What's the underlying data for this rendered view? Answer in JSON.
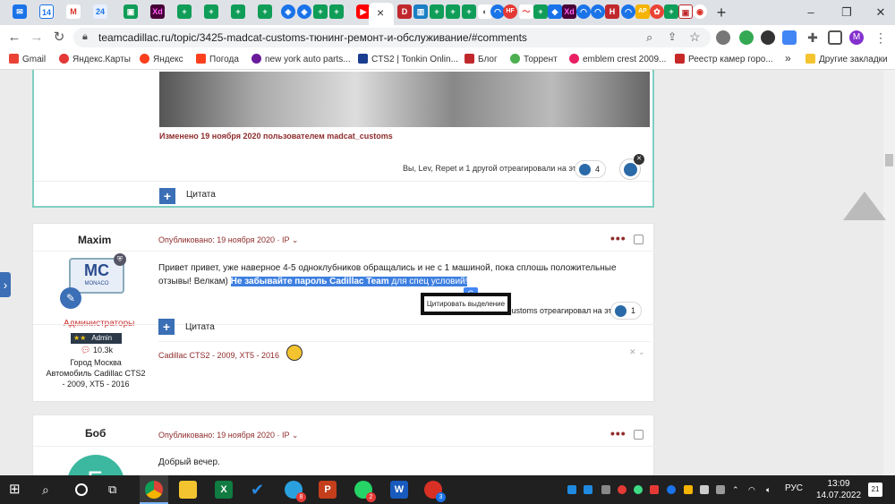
{
  "browser": {
    "tab_labels": [
      "14",
      "M",
      "24",
      "Xd",
      "D",
      "Xd",
      "H",
      "HF"
    ],
    "active_tab_close": "×",
    "new_tab": "+",
    "window_controls": {
      "minimize": "–",
      "restore": "❐",
      "close": "✕"
    },
    "url": "teamcadillac.ru/topic/3425-madcat-customs-тюнинг-ремонт-и-обслуживание/#comments",
    "profile_initial": "M",
    "bookmarks": [
      "Gmail",
      "Яндекс.Карты",
      "Яндекс",
      "Погода",
      "new york auto parts...",
      "CTS2 | Tonkin Onlin...",
      "Блог",
      "Торрент",
      "emblem crest 2009...",
      "Реестр камер горо..."
    ],
    "bookmarks_more": "»",
    "other_bookmarks": "Другие закладки"
  },
  "post1": {
    "edited": "Изменено 19 ноября 2020 пользователем madcat_customs",
    "reactions_text": "Вы, Lev, Repet и 1 другой отреагировали на это",
    "reaction_count": "4",
    "quote_label": "Цитата",
    "quote_plus": "+"
  },
  "post2": {
    "author": "Maxim",
    "avatar_text": "MC",
    "avatar_sub": "MONACO",
    "published": "Опубликовано: 19 ноября 2020 · IP ⌄",
    "group": "Администраторы",
    "rank": "Admin",
    "rank_stars": "★★",
    "posts_count": "10.3k",
    "city": "Город Москва",
    "car": "Автомобиль Cadillac CTS2 - 2009, XT5 - 2016",
    "more_dots": "•••",
    "body_plain": "Привет привет, уже наверное 4-5 одноклубников обращались и не с 1 машиной, пока сплошь положительные отзывы! Велкам)",
    "body_bold": "Не забывайте пароль Cadillac Team",
    "body_tail": " для спец условий!",
    "reactions_tail": "customs отреагировал на это",
    "reaction_count": "1",
    "quote_selection_tooltip": "Цитировать выделение",
    "quote_label": "Цитата",
    "quote_plus": "+",
    "signature": "Cadillac CTS2 - 2009, XT5 - 2016",
    "sig_close": "✕ ⌄"
  },
  "post3": {
    "author": "Боб",
    "avatar_letter": "Б",
    "published": "Опубликовано: 19 ноября 2020 · IP ⌄",
    "more_dots": "•••",
    "body": "Добрый вечер."
  },
  "side_tab": "›",
  "taskbar": {
    "lang": "РУС",
    "time": "13:09",
    "date": "14.07.2022",
    "notif_count": "21",
    "badges": [
      "8",
      "2",
      "3"
    ]
  },
  "colors": {
    "accent": "#3b6fb6",
    "post_title": "#8f2c2c",
    "highlight": "#3d7fe0",
    "admin_group": "#d03030",
    "post_border_green": "#7fcfc0"
  }
}
